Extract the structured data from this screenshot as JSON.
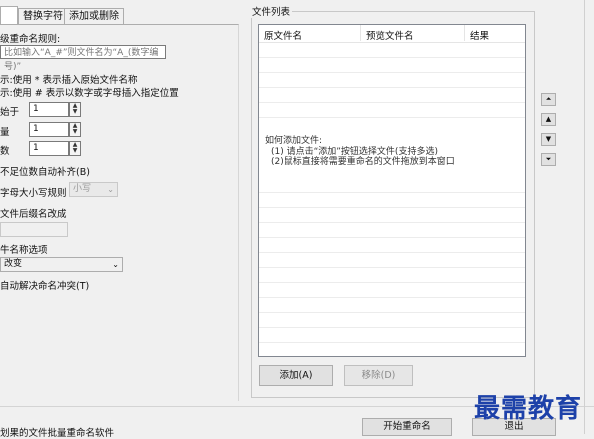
{
  "tabs": [
    {
      "label": ""
    },
    {
      "label": "替换字符"
    },
    {
      "label": "添加或删除"
    }
  ],
  "left": {
    "rule_label": "级重命名规则:",
    "rule_placeholder": "比如输入“A_#”则文件名为“A_(数字编号)”",
    "hint1": "示:使用 * 表示插入原始文件名称",
    "hint2": "示:使用 # 表示以数字或字母插入指定位置",
    "start_label": "始于",
    "start_value": "1",
    "step_label": "量",
    "step_value": "1",
    "digits_label": "数",
    "digits_value": "1",
    "auto_pad": "不足位数自动补齐(B)",
    "case_label": "字母大小写规则",
    "case_value": "小写",
    "ext_label": "文件后缀名改成",
    "ext_value": "",
    "name_option_label": "牛名称选项",
    "name_option_value": "改变",
    "auto_resolve": "自动解决命名冲突(T)",
    "bottom_text": "划果的文件批量重命名软件"
  },
  "file_list": {
    "group_title": "文件列表",
    "columns": [
      "原文件名",
      "预览文件名",
      "结果"
    ],
    "hint_title": "如何添加文件:",
    "hint_line1": "(1) 请点击“添加”按钮选择文件(支持多选)",
    "hint_line2": "(2)鼠标直接将需要重命名的文件拖放到本窗口",
    "add_button": "添加(A)",
    "remove_button": "移除(D)"
  },
  "side_buttons": [
    {
      "icon": "move-top-icon",
      "glyph": "⏶"
    },
    {
      "icon": "move-up-icon",
      "glyph": "▲"
    },
    {
      "icon": "move-down-icon",
      "glyph": "▼"
    },
    {
      "icon": "move-bottom-icon",
      "glyph": "⏷"
    }
  ],
  "actions": {
    "start": "开始重命名",
    "exit": "退出"
  },
  "watermark": "最需教育"
}
